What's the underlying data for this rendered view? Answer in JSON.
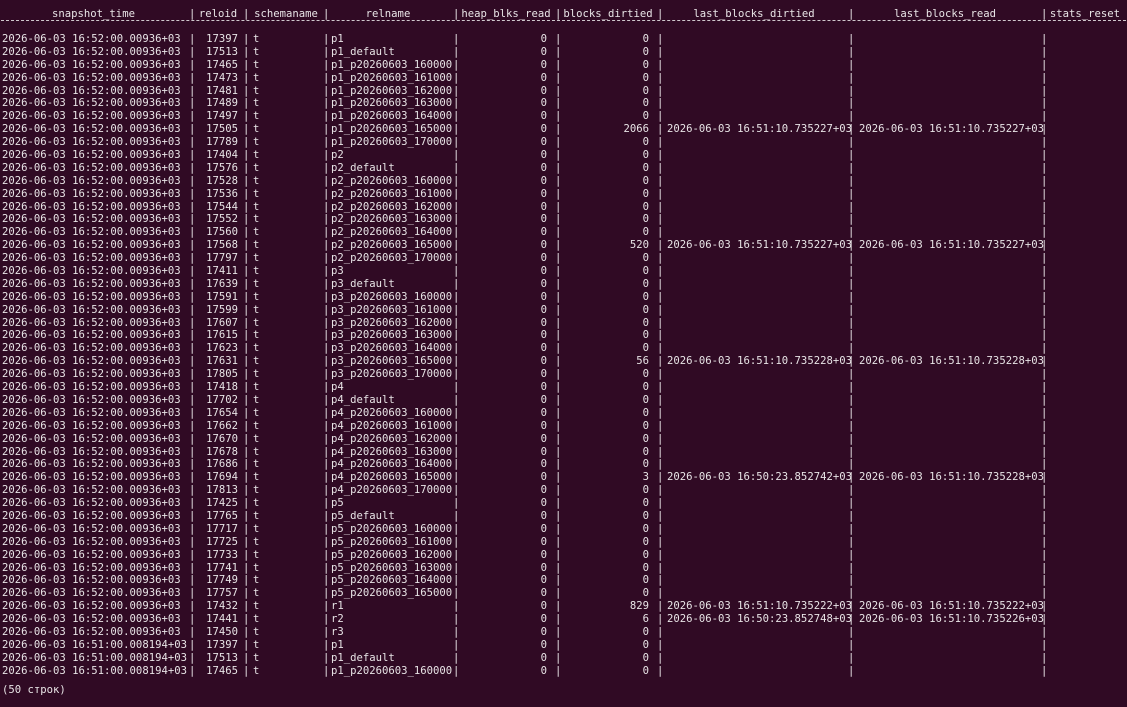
{
  "headers": [
    "snapshot_time",
    "reloid",
    "schemaname",
    "relname",
    "heap_blks_read",
    "blocks_dirtied",
    "last_blocks_dirtied",
    "last_blocks_read",
    "stats_reset"
  ],
  "rows": [
    [
      "2026-06-03 16:52:00.00936+03",
      "17397",
      "t",
      "p1",
      "0",
      "0",
      "",
      "",
      ""
    ],
    [
      "2026-06-03 16:52:00.00936+03",
      "17513",
      "t",
      "p1_default",
      "0",
      "0",
      "",
      "",
      ""
    ],
    [
      "2026-06-03 16:52:00.00936+03",
      "17465",
      "t",
      "p1_p20260603_160000",
      "0",
      "0",
      "",
      "",
      ""
    ],
    [
      "2026-06-03 16:52:00.00936+03",
      "17473",
      "t",
      "p1_p20260603_161000",
      "0",
      "0",
      "",
      "",
      ""
    ],
    [
      "2026-06-03 16:52:00.00936+03",
      "17481",
      "t",
      "p1_p20260603_162000",
      "0",
      "0",
      "",
      "",
      ""
    ],
    [
      "2026-06-03 16:52:00.00936+03",
      "17489",
      "t",
      "p1_p20260603_163000",
      "0",
      "0",
      "",
      "",
      ""
    ],
    [
      "2026-06-03 16:52:00.00936+03",
      "17497",
      "t",
      "p1_p20260603_164000",
      "0",
      "0",
      "",
      "",
      ""
    ],
    [
      "2026-06-03 16:52:00.00936+03",
      "17505",
      "t",
      "p1_p20260603_165000",
      "0",
      "2066",
      "2026-06-03 16:51:10.735227+03",
      "2026-06-03 16:51:10.735227+03",
      ""
    ],
    [
      "2026-06-03 16:52:00.00936+03",
      "17789",
      "t",
      "p1_p20260603_170000",
      "0",
      "0",
      "",
      "",
      ""
    ],
    [
      "2026-06-03 16:52:00.00936+03",
      "17404",
      "t",
      "p2",
      "0",
      "0",
      "",
      "",
      ""
    ],
    [
      "2026-06-03 16:52:00.00936+03",
      "17576",
      "t",
      "p2_default",
      "0",
      "0",
      "",
      "",
      ""
    ],
    [
      "2026-06-03 16:52:00.00936+03",
      "17528",
      "t",
      "p2_p20260603_160000",
      "0",
      "0",
      "",
      "",
      ""
    ],
    [
      "2026-06-03 16:52:00.00936+03",
      "17536",
      "t",
      "p2_p20260603_161000",
      "0",
      "0",
      "",
      "",
      ""
    ],
    [
      "2026-06-03 16:52:00.00936+03",
      "17544",
      "t",
      "p2_p20260603_162000",
      "0",
      "0",
      "",
      "",
      ""
    ],
    [
      "2026-06-03 16:52:00.00936+03",
      "17552",
      "t",
      "p2_p20260603_163000",
      "0",
      "0",
      "",
      "",
      ""
    ],
    [
      "2026-06-03 16:52:00.00936+03",
      "17560",
      "t",
      "p2_p20260603_164000",
      "0",
      "0",
      "",
      "",
      ""
    ],
    [
      "2026-06-03 16:52:00.00936+03",
      "17568",
      "t",
      "p2_p20260603_165000",
      "0",
      "520",
      "2026-06-03 16:51:10.735227+03",
      "2026-06-03 16:51:10.735227+03",
      ""
    ],
    [
      "2026-06-03 16:52:00.00936+03",
      "17797",
      "t",
      "p2_p20260603_170000",
      "0",
      "0",
      "",
      "",
      ""
    ],
    [
      "2026-06-03 16:52:00.00936+03",
      "17411",
      "t",
      "p3",
      "0",
      "0",
      "",
      "",
      ""
    ],
    [
      "2026-06-03 16:52:00.00936+03",
      "17639",
      "t",
      "p3_default",
      "0",
      "0",
      "",
      "",
      ""
    ],
    [
      "2026-06-03 16:52:00.00936+03",
      "17591",
      "t",
      "p3_p20260603_160000",
      "0",
      "0",
      "",
      "",
      ""
    ],
    [
      "2026-06-03 16:52:00.00936+03",
      "17599",
      "t",
      "p3_p20260603_161000",
      "0",
      "0",
      "",
      "",
      ""
    ],
    [
      "2026-06-03 16:52:00.00936+03",
      "17607",
      "t",
      "p3_p20260603_162000",
      "0",
      "0",
      "",
      "",
      ""
    ],
    [
      "2026-06-03 16:52:00.00936+03",
      "17615",
      "t",
      "p3_p20260603_163000",
      "0",
      "0",
      "",
      "",
      ""
    ],
    [
      "2026-06-03 16:52:00.00936+03",
      "17623",
      "t",
      "p3_p20260603_164000",
      "0",
      "0",
      "",
      "",
      ""
    ],
    [
      "2026-06-03 16:52:00.00936+03",
      "17631",
      "t",
      "p3_p20260603_165000",
      "0",
      "56",
      "2026-06-03 16:51:10.735228+03",
      "2026-06-03 16:51:10.735228+03",
      ""
    ],
    [
      "2026-06-03 16:52:00.00936+03",
      "17805",
      "t",
      "p3_p20260603_170000",
      "0",
      "0",
      "",
      "",
      ""
    ],
    [
      "2026-06-03 16:52:00.00936+03",
      "17418",
      "t",
      "p4",
      "0",
      "0",
      "",
      "",
      ""
    ],
    [
      "2026-06-03 16:52:00.00936+03",
      "17702",
      "t",
      "p4_default",
      "0",
      "0",
      "",
      "",
      ""
    ],
    [
      "2026-06-03 16:52:00.00936+03",
      "17654",
      "t",
      "p4_p20260603_160000",
      "0",
      "0",
      "",
      "",
      ""
    ],
    [
      "2026-06-03 16:52:00.00936+03",
      "17662",
      "t",
      "p4_p20260603_161000",
      "0",
      "0",
      "",
      "",
      ""
    ],
    [
      "2026-06-03 16:52:00.00936+03",
      "17670",
      "t",
      "p4_p20260603_162000",
      "0",
      "0",
      "",
      "",
      ""
    ],
    [
      "2026-06-03 16:52:00.00936+03",
      "17678",
      "t",
      "p4_p20260603_163000",
      "0",
      "0",
      "",
      "",
      ""
    ],
    [
      "2026-06-03 16:52:00.00936+03",
      "17686",
      "t",
      "p4_p20260603_164000",
      "0",
      "0",
      "",
      "",
      ""
    ],
    [
      "2026-06-03 16:52:00.00936+03",
      "17694",
      "t",
      "p4_p20260603_165000",
      "0",
      "3",
      "2026-06-03 16:50:23.852742+03",
      "2026-06-03 16:51:10.735228+03",
      ""
    ],
    [
      "2026-06-03 16:52:00.00936+03",
      "17813",
      "t",
      "p4_p20260603_170000",
      "0",
      "0",
      "",
      "",
      ""
    ],
    [
      "2026-06-03 16:52:00.00936+03",
      "17425",
      "t",
      "p5",
      "0",
      "0",
      "",
      "",
      ""
    ],
    [
      "2026-06-03 16:52:00.00936+03",
      "17765",
      "t",
      "p5_default",
      "0",
      "0",
      "",
      "",
      ""
    ],
    [
      "2026-06-03 16:52:00.00936+03",
      "17717",
      "t",
      "p5_p20260603_160000",
      "0",
      "0",
      "",
      "",
      ""
    ],
    [
      "2026-06-03 16:52:00.00936+03",
      "17725",
      "t",
      "p5_p20260603_161000",
      "0",
      "0",
      "",
      "",
      ""
    ],
    [
      "2026-06-03 16:52:00.00936+03",
      "17733",
      "t",
      "p5_p20260603_162000",
      "0",
      "0",
      "",
      "",
      ""
    ],
    [
      "2026-06-03 16:52:00.00936+03",
      "17741",
      "t",
      "p5_p20260603_163000",
      "0",
      "0",
      "",
      "",
      ""
    ],
    [
      "2026-06-03 16:52:00.00936+03",
      "17749",
      "t",
      "p5_p20260603_164000",
      "0",
      "0",
      "",
      "",
      ""
    ],
    [
      "2026-06-03 16:52:00.00936+03",
      "17757",
      "t",
      "p5_p20260603_165000",
      "0",
      "0",
      "",
      "",
      ""
    ],
    [
      "2026-06-03 16:52:00.00936+03",
      "17432",
      "t",
      "r1",
      "0",
      "829",
      "2026-06-03 16:51:10.735222+03",
      "2026-06-03 16:51:10.735222+03",
      ""
    ],
    [
      "2026-06-03 16:52:00.00936+03",
      "17441",
      "t",
      "r2",
      "0",
      "6",
      "2026-06-03 16:50:23.852748+03",
      "2026-06-03 16:51:10.735226+03",
      ""
    ],
    [
      "2026-06-03 16:52:00.00936+03",
      "17450",
      "t",
      "r3",
      "0",
      "0",
      "",
      "",
      ""
    ],
    [
      "2026-06-03 16:51:00.008194+03",
      "17397",
      "t",
      "p1",
      "0",
      "0",
      "",
      "",
      ""
    ],
    [
      "2026-06-03 16:51:00.008194+03",
      "17513",
      "t",
      "p1_default",
      "0",
      "0",
      "",
      "",
      ""
    ],
    [
      "2026-06-03 16:51:00.008194+03",
      "17465",
      "t",
      "p1_p20260603_160000",
      "0",
      "0",
      "",
      "",
      ""
    ]
  ],
  "footer": "(50 строк)",
  "colors": {
    "background": "#300a24",
    "text": "#e8e4e6"
  }
}
